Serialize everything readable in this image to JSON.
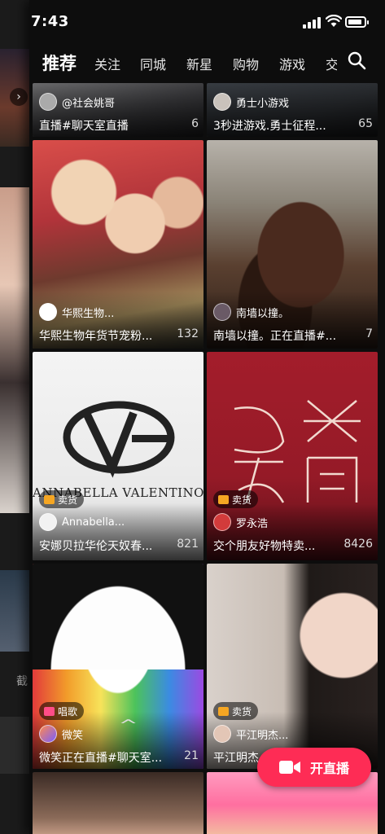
{
  "status": {
    "time": "7:43"
  },
  "tabs": [
    {
      "label": "推荐",
      "active": true
    },
    {
      "label": "关注"
    },
    {
      "label": "同城"
    },
    {
      "label": "新星"
    },
    {
      "label": "购物"
    },
    {
      "label": "游戏"
    },
    {
      "label": "交"
    }
  ],
  "search_icon": "search-icon",
  "side_panel": {
    "cut_label": "截"
  },
  "cards": [
    {
      "author": "@社会姚哥",
      "title": "直播#聊天室直播",
      "count": "6"
    },
    {
      "author": "勇士小游戏",
      "title": "3秒进游戏.勇士征程...",
      "count": "65"
    },
    {
      "author": "华熙生物...",
      "title": "华熙生物年货节宠粉...",
      "count": "132"
    },
    {
      "author": "南墙以撞。",
      "title": "南墙以撞。正在直播#...",
      "count": "7"
    },
    {
      "badge": "卖货",
      "author": "Annabella...",
      "title": "安娜贝拉华伦天奴春...",
      "count": "821",
      "logo_text": "ANNABELLA VALENTINO"
    },
    {
      "badge": "卖货",
      "author": "罗永浩",
      "title": "交个朋友好物特卖...",
      "count": "8426"
    },
    {
      "badge": "唱歌",
      "author": "微笑",
      "title": "微笑正在直播#聊天室...",
      "count": "21"
    },
    {
      "badge": "卖货",
      "author": "平江明杰...",
      "title": "平江明杰",
      "count": ""
    }
  ],
  "live_button": {
    "label": "开直播"
  },
  "colors": {
    "accent": "#fe2c55",
    "background": "#0d0d0d",
    "badge_shop": "#f5a623",
    "badge_sing": "#ff4d88"
  }
}
